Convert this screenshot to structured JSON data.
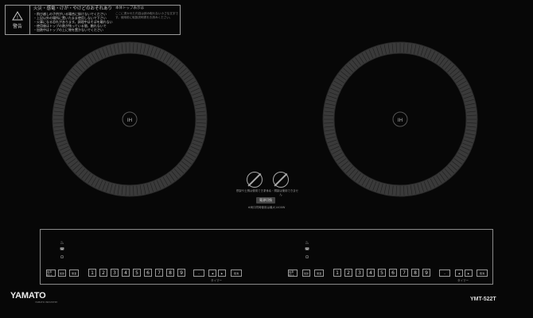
{
  "warning": {
    "icon": "warning-triangle-icon",
    "mark_label": "警告",
    "headline": "火災・感電・けが・やけどのおそれあり",
    "items": [
      "・飛び越しの子供がいる場合に掛けないでください",
      "・上記以外の場所に置いたまま使用しないで下さい",
      "・火事になる恐れがあります。調理中はそばを離れない",
      "・使用後はトップの熱が残っている間、触れないで",
      "・加熱中はトップの上に物を置かないでください"
    ]
  },
  "caption_right": "本体トップ表示は",
  "caption_note": "ここに書かれた内容は読み取れない小さな文字です。使用前に取扱説明書をお読みください。",
  "hobs": {
    "left_label": "IH",
    "right_label": "IH"
  },
  "center": {
    "left_prohibit_icon": "no-pan-icon",
    "right_prohibit_icon": "no-metal-icon",
    "left_caption": "鉄製や土鍋は使用できません",
    "right_caption": "アルミ・銅製は使用できません",
    "center_button": "電源切換",
    "center_note": "※両口同時使用は最大1400W"
  },
  "controls": {
    "left": {
      "top_icon_1": "kettle-icon",
      "top_icon_2": "pot-icon",
      "top_icon_3": "lock-icon",
      "power": "電源\n切/入",
      "mode": "加熱",
      "mode2": "保温",
      "digits": [
        "1",
        "2",
        "3",
        "4",
        "5",
        "6",
        "7",
        "8",
        "9"
      ],
      "minus": "−",
      "timer_left": "◀",
      "timer_right": "▶",
      "timer_set": "タイマー",
      "timer_label": "タイマー",
      "reset": "取消"
    },
    "right": {
      "top_icon_1": "kettle-icon",
      "top_icon_2": "pot-icon",
      "top_icon_3": "lock-icon",
      "power": "電源\n切/入",
      "mode": "加熱",
      "mode2": "保温",
      "digits": [
        "1",
        "2",
        "3",
        "4",
        "5",
        "6",
        "7",
        "8",
        "9"
      ],
      "minus": "−",
      "timer_left": "◀",
      "timer_right": "▶",
      "timer_set": "タイマー",
      "timer_label": "タイマー",
      "reset": "取消"
    }
  },
  "brand": "YAMATO",
  "brand_sub": "YAMATO INDUSTRY",
  "model": "YMT-522T"
}
